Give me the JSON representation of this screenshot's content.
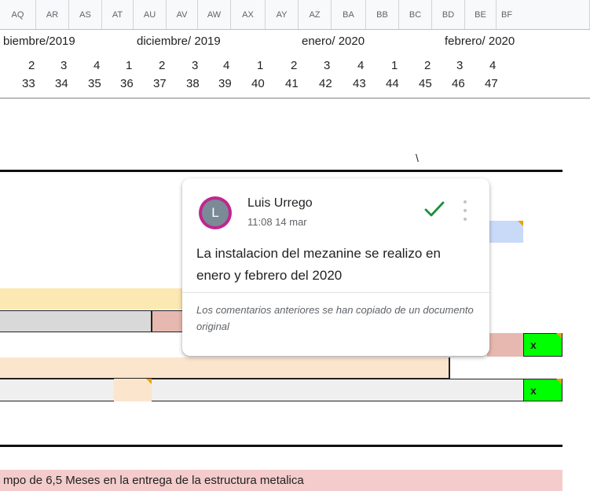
{
  "columns": [
    "AQ",
    "AR",
    "AS",
    "AT",
    "AU",
    "AV",
    "AW",
    "AX",
    "AY",
    "AZ",
    "BA",
    "BB",
    "BC",
    "BD",
    "BE",
    "BF"
  ],
  "months": [
    "biembre/2019",
    "diciembre/ 2019",
    "enero/ 2020",
    "febrero/ 2020"
  ],
  "week_numbers": [
    "2",
    "3",
    "4",
    "1",
    "2",
    "3",
    "4",
    "1",
    "2",
    "3",
    "4",
    "1",
    "2",
    "3",
    "4"
  ],
  "sequence_numbers": [
    "33",
    "34",
    "35",
    "36",
    "37",
    "38",
    "39",
    "40",
    "41",
    "42",
    "43",
    "44",
    "45",
    "46",
    "47"
  ],
  "stray_mark": "\\",
  "x_markers": [
    "x",
    "x"
  ],
  "bottom_note": "mpo de 6,5 Meses en la entrega de la estructura metalica",
  "comment": {
    "avatar_initial": "L",
    "author": "Luis Urrego",
    "timestamp": "11:08 14 mar",
    "body": "La instalacion del mezanine se realizo en enero y febrero del 2020",
    "note": "Los comentarios anteriores se han copiado de un documento original"
  },
  "colors": {
    "yellow_bar": "#fce8b2",
    "gray_bar": "#d9d9d9",
    "rose_bar": "#e6b8af",
    "peach_bar": "#fce5cd",
    "light_gray_bar": "#efefef",
    "blue_bar": "#c9daf8",
    "green_cell": "#00ff00",
    "bottom_band": "#f4cccc",
    "resolve_check": "#1e8e3e"
  },
  "icons": {
    "resolve": "checkmark-icon",
    "more": "more-vertical-icon",
    "note_marker": "comment-triangle-icon"
  }
}
